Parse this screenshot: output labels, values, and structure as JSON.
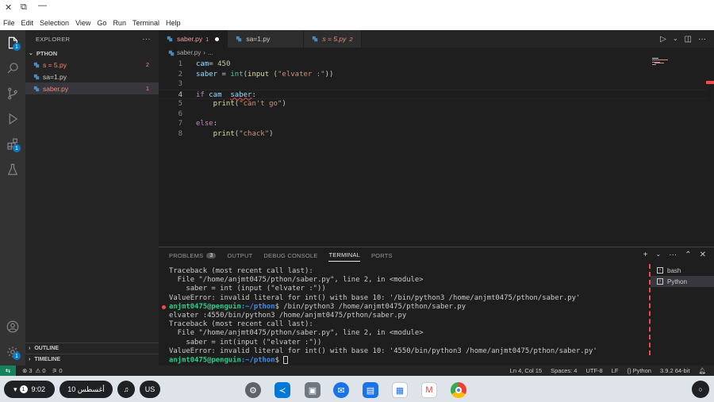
{
  "window": {
    "close": "✕",
    "restore": "⧉",
    "minimize": "—"
  },
  "menu": [
    "File",
    "Edit",
    "Selection",
    "View",
    "Go",
    "Run",
    "Terminal",
    "Help"
  ],
  "activity": {
    "explorer_badge": "1",
    "extensions_badge": "1",
    "settings_badge": "1"
  },
  "explorer": {
    "title": "EXPLORER",
    "more": "···",
    "folder": "PTHON",
    "files": [
      {
        "name": "s = 5.py",
        "count": "2",
        "color": "#f48771"
      },
      {
        "name": "sa=1.py",
        "count": "",
        "color": "#cccccc"
      },
      {
        "name": "saber.py",
        "count": "1",
        "color": "#f48771"
      }
    ],
    "outline": "OUTLINE",
    "timeline": "TIMELINE"
  },
  "tabs": [
    {
      "label": "saber.py",
      "num": "1",
      "dirty": true
    },
    {
      "label": "sa=1.py",
      "num": "",
      "dirty": false
    },
    {
      "label": "s = 5.py",
      "num": "2",
      "dirty": false
    }
  ],
  "breadcrumb": {
    "file": "saber.py",
    "sep": "›",
    "more": "..."
  },
  "code": {
    "line_numbers": [
      "1",
      "2",
      "3",
      "4",
      "5",
      "6",
      "7",
      "8"
    ],
    "l1_var": "cam",
    "l1_op": "= ",
    "l1_num": "450",
    "l2_var": "saber",
    "l2_op": " = ",
    "l2_fn1": "int",
    "l2_p1": "(",
    "l2_fn2": "input",
    "l2_p2": " (",
    "l2_str": "\"elvater :\"",
    "l2_p3": "))",
    "l4_kw": "if",
    "l4_var": " cam  ",
    "l4_squig": "saber",
    "l4_colon": ":",
    "l5_fn": "    print",
    "l5_p1": "(",
    "l5_str": "\"can't go\"",
    "l5_p2": ")",
    "l7_kw": "else",
    "l7_colon": ":",
    "l8_fn": "    print",
    "l8_p1": "(",
    "l8_str": "\"chack\"",
    "l8_p2": ")"
  },
  "panel": {
    "tabs": [
      "PROBLEMS",
      "OUTPUT",
      "DEBUG CONSOLE",
      "TERMINAL",
      "PORTS"
    ],
    "problems_count": "3",
    "actions": [
      "+",
      "⌄",
      "···",
      "⌃",
      "✕"
    ]
  },
  "terminal": {
    "lines": [
      "Traceback (most recent call last):",
      "  File \"/home/anjmt0475/pthon/saber.py\", line 2, in <module>",
      "    saber = int (input (\"elvater :\"))",
      "ValueError: invalid literal for int() with base 10: '/bin/python3 /home/anjmt0475/pthon/saber.py'"
    ],
    "prompt1_user": "anjmt0475@penguin",
    "prompt1_path": ":~/pthon",
    "prompt1_cmd": "$ /bin/python3 /home/anjmt0475/pthon/saber.py",
    "lines2": [
      "elvater :4550/bin/python3 /home/anjmt0475/pthon/saber.py",
      "Traceback (most recent call last):",
      "  File \"/home/anjmt0475/pthon/saber.py\", line 2, in <module>",
      "    saber = int(input (\"elvater :\"))",
      "ValueError: invalid literal for int() with base 10: '4550/bin/python3 /home/anjmt0475/pthon/saber.py'"
    ],
    "prompt2_user": "anjmt0475@penguin",
    "prompt2_path": ":~/pthon",
    "prompt2_cmd": "$ ",
    "sessions": [
      "bash",
      "Python"
    ]
  },
  "status": {
    "errors": "⊗ 3",
    "warnings": "⚠ 0",
    "ports": "⚞ 0",
    "position": "Ln 4, Col 15",
    "spaces": "Spaces: 4",
    "encoding": "UTF-8",
    "eol": "LF",
    "language": "Python",
    "interpreter": "3.9.2 64-bit"
  },
  "shelf": {
    "notif": "1",
    "time": "9:02",
    "date": "10 أغسطس",
    "ime": "US"
  }
}
